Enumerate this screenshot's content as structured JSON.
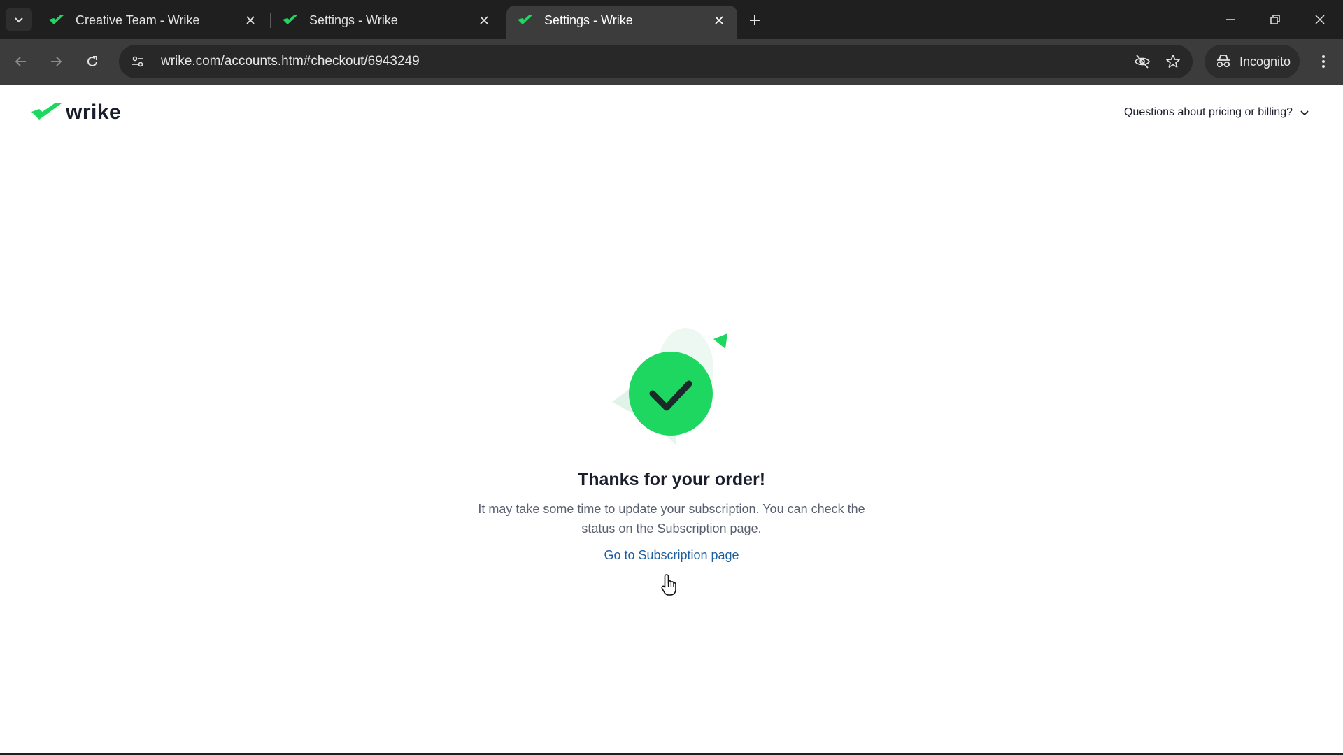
{
  "browser": {
    "tabs": [
      {
        "title": "Creative Team - Wrike",
        "active": false
      },
      {
        "title": "Settings - Wrike",
        "active": false
      },
      {
        "title": "Settings - Wrike",
        "active": true
      }
    ],
    "url": "wrike.com/accounts.htm#checkout/6943249",
    "incognito_label": "Incognito"
  },
  "page": {
    "logo_text": "wrike",
    "billing_question": "Questions about pricing or billing?",
    "heading": "Thanks for your order!",
    "description": "It may take some time to update your subscription. You can check the status on the Subscription page.",
    "link_label": "Go to Subscription page"
  },
  "colors": {
    "brand_green": "#1ed760",
    "link_blue": "#1f5e9e",
    "chrome_dark": "#1f1f1f",
    "chrome_toolbar": "#3c3c3c"
  }
}
